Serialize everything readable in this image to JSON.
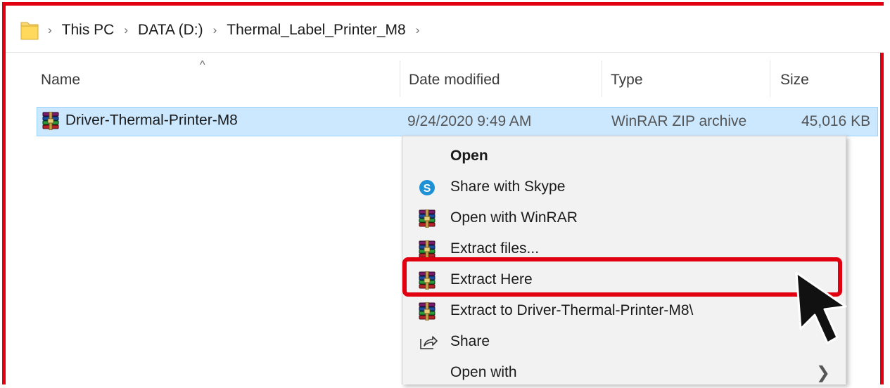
{
  "breadcrumb": {
    "items": [
      "This PC",
      "DATA (D:)",
      "Thermal_Label_Printer_M8"
    ],
    "separator": "›"
  },
  "columns": {
    "name": "Name",
    "date": "Date modified",
    "type": "Type",
    "size": "Size",
    "sort_indicator": "^"
  },
  "files": [
    {
      "name": "Driver-Thermal-Printer-M8",
      "date": "9/24/2020 9:49 AM",
      "type": "WinRAR ZIP archive",
      "size": "45,016 KB",
      "icon": "winrar-archive-icon"
    }
  ],
  "context_menu": {
    "items": [
      {
        "label": "Open",
        "icon": "",
        "bold": true
      },
      {
        "label": "Share with Skype",
        "icon": "skype-icon"
      },
      {
        "label": "Open with WinRAR",
        "icon": "winrar-icon"
      },
      {
        "label": "Extract files...",
        "icon": "winrar-icon"
      },
      {
        "label": "Extract Here",
        "icon": "winrar-icon",
        "highlighted": true
      },
      {
        "label": "Extract to Driver-Thermal-Printer-M8\\",
        "icon": "winrar-icon"
      },
      {
        "label": "Share",
        "icon": "share-icon"
      },
      {
        "label": "Open with",
        "icon": "",
        "submenu": true
      }
    ]
  },
  "colors": {
    "annotation_red": "#e0000f",
    "selection_fill": "#cce8ff",
    "selection_border": "#99d1ff",
    "menu_background": "#f2f2f2"
  }
}
